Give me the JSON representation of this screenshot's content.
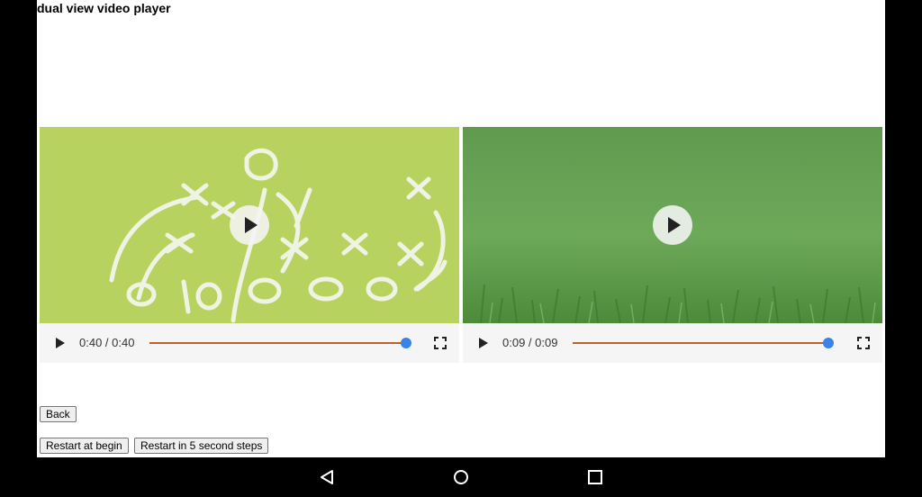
{
  "page": {
    "title": "dual view video player"
  },
  "videos": [
    {
      "time": "0:40 / 0:40",
      "progress": 1.0,
      "thumbnail": "chalk-football-play-diagram",
      "accent": "#b8d25f"
    },
    {
      "time": "0:09 / 0:09",
      "progress": 1.0,
      "thumbnail": "grass-field",
      "accent": "#6aa458"
    }
  ],
  "buttons": {
    "back": "Back",
    "restart_begin": "Restart at begin",
    "restart_steps": "Restart in 5 second steps"
  },
  "navbar": {
    "icons": [
      "back-icon",
      "home-icon",
      "recents-icon"
    ]
  },
  "colors": {
    "progress": "#c0612b",
    "thumb": "#3b82e6"
  }
}
